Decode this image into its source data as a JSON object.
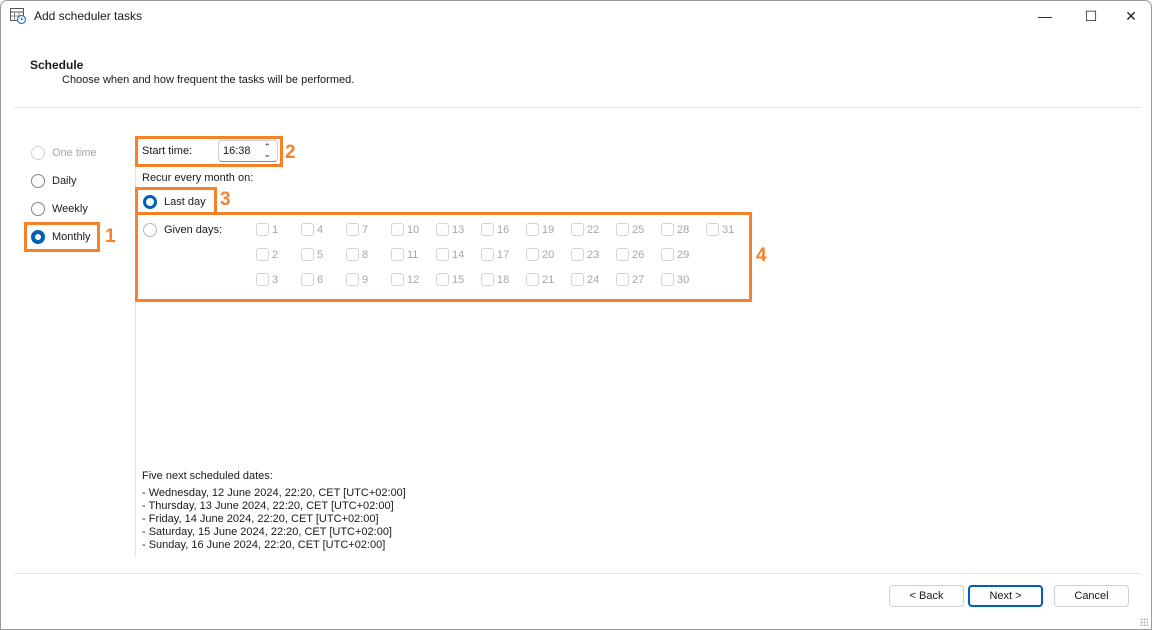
{
  "window": {
    "title": "Add scheduler tasks",
    "controls": {
      "minimize": "—",
      "maximize": "☐",
      "close": "✕"
    }
  },
  "header": {
    "title": "Schedule",
    "subtitle": "Choose when and how frequent the tasks will be performed."
  },
  "frequency": {
    "options": [
      {
        "label": "One time",
        "state": "disabled"
      },
      {
        "label": "Daily",
        "state": "unchecked"
      },
      {
        "label": "Weekly",
        "state": "unchecked"
      },
      {
        "label": "Monthly",
        "state": "checked"
      }
    ]
  },
  "start_time": {
    "label": "Start time:",
    "value": "16:38"
  },
  "recur": {
    "label": "Recur every month on:",
    "last_day_label": "Last day",
    "given_days_label": "Given days:",
    "days": [
      "1",
      "4",
      "7",
      "10",
      "13",
      "16",
      "19",
      "22",
      "25",
      "28",
      "31",
      "2",
      "5",
      "8",
      "11",
      "14",
      "17",
      "20",
      "23",
      "26",
      "29",
      "3",
      "6",
      "9",
      "12",
      "15",
      "18",
      "21",
      "24",
      "27",
      "30"
    ]
  },
  "next_dates": {
    "title": "Five next scheduled dates:",
    "items": [
      "- Wednesday, 12 June 2024, 22:20, CET [UTC+02:00]",
      "- Thursday, 13 June 2024, 22:20, CET [UTC+02:00]",
      "- Friday, 14 June 2024, 22:20, CET [UTC+02:00]",
      "- Saturday, 15 June 2024, 22:20, CET [UTC+02:00]",
      "- Sunday, 16 June 2024, 22:20, CET [UTC+02:00]"
    ]
  },
  "annotations": [
    "1",
    "2",
    "3",
    "4"
  ],
  "buttons": {
    "back": "< Back",
    "next": "Next >",
    "cancel": "Cancel"
  },
  "colors": {
    "accent": "#005fb8",
    "annotation": "#f5822a",
    "disabled_text": "#a6a6a6"
  }
}
